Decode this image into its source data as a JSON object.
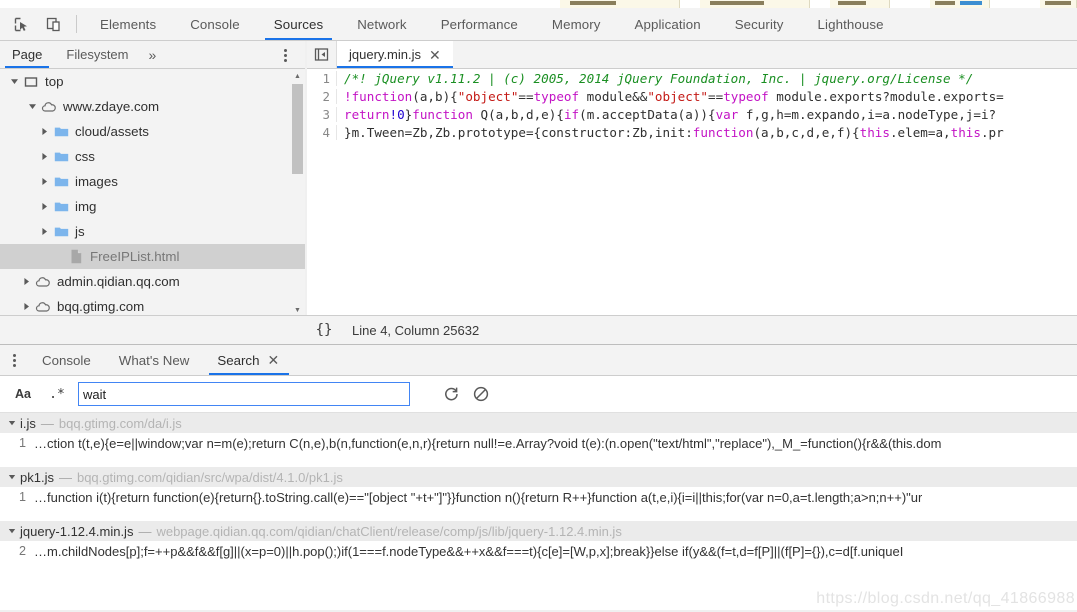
{
  "toolbar": {
    "inspect_icon": "inspect-cursor-icon",
    "device_icon": "device-toggle-icon",
    "tabs": [
      {
        "label": "Elements",
        "selected": false
      },
      {
        "label": "Console",
        "selected": false
      },
      {
        "label": "Sources",
        "selected": true
      },
      {
        "label": "Network",
        "selected": false
      },
      {
        "label": "Performance",
        "selected": false
      },
      {
        "label": "Memory",
        "selected": false
      },
      {
        "label": "Application",
        "selected": false
      },
      {
        "label": "Security",
        "selected": false
      },
      {
        "label": "Lighthouse",
        "selected": false
      }
    ]
  },
  "navigator": {
    "tabs": [
      {
        "label": "Page",
        "selected": true
      },
      {
        "label": "Filesystem",
        "selected": false
      }
    ],
    "more_label": "»",
    "kebab_icon": "more-options-icon",
    "tree": [
      {
        "label": "top",
        "icon": "frame-icon",
        "twisty": "expanded",
        "indent": 0,
        "selected": false
      },
      {
        "label": "www.zdaye.com",
        "icon": "cloud-icon",
        "twisty": "expanded",
        "indent": 1,
        "selected": false
      },
      {
        "label": "cloud/assets",
        "icon": "folder-icon",
        "twisty": "collapsed",
        "indent": 2,
        "selected": false
      },
      {
        "label": "css",
        "icon": "folder-icon",
        "twisty": "collapsed",
        "indent": 2,
        "selected": false
      },
      {
        "label": "images",
        "icon": "folder-icon",
        "twisty": "collapsed",
        "indent": 2,
        "selected": false
      },
      {
        "label": "img",
        "icon": "folder-icon",
        "twisty": "collapsed",
        "indent": 2,
        "selected": false
      },
      {
        "label": "js",
        "icon": "folder-icon",
        "twisty": "collapsed",
        "indent": 2,
        "selected": false
      },
      {
        "label": "FreeIPList.html",
        "icon": "document-icon",
        "twisty": "none",
        "indent": 3,
        "selected": true
      },
      {
        "label": "admin.qidian.qq.com",
        "icon": "cloud-icon",
        "twisty": "collapsed",
        "indent": 1,
        "selected": false
      },
      {
        "label": "bqq.gtimg.com",
        "icon": "cloud-icon",
        "twisty": "collapsed",
        "indent": 1,
        "selected": false
      }
    ]
  },
  "editor": {
    "back_icon": "show-navigator-icon",
    "tab_label": "jquery.min.js",
    "close_icon": "close-icon",
    "lines": [
      {
        "n": "1"
      },
      {
        "n": "2"
      },
      {
        "n": "3"
      },
      {
        "n": "4"
      }
    ],
    "code": {
      "line1_comment": "/*! jQuery v1.11.2 | (c) 2005, 2014 jQuery Foundation, Inc. | jquery.org/License */",
      "line2_a": "!function",
      "line2_b": "(a,b){",
      "line2_c": "\"object\"",
      "line2_d": "==",
      "line2_e": "typeof",
      "line2_f": " module&&",
      "line2_g": "\"object\"",
      "line2_h": "==",
      "line2_i": "typeof",
      "line2_j": " module.exports?module.exports=",
      "line3_a": "return",
      "line3_b": "!0",
      "line3_c": "}",
      "line3_d": "function",
      "line3_e": " Q(a,b,d,e){",
      "line3_f": "if",
      "line3_g": "(m.acceptData(a)){",
      "line3_h": "var",
      "line3_i": " f,g,h=m.expando,i=a.nodeType,j=i?",
      "line4_a": "}m.Tween=Zb,Zb.prototype={constructor:Zb,init:",
      "line4_b": "function",
      "line4_c": "(a,b,c,d,e,f){",
      "line4_d": "this",
      "line4_e": ".elem=a,",
      "line4_f": "this",
      "line4_g": ".pr"
    },
    "status": {
      "pretty_print_label": "{}",
      "cursor_position": "Line 4, Column 25632"
    }
  },
  "drawer": {
    "kebab_icon": "more-tools-icon",
    "tabs": [
      {
        "label": "Console",
        "selected": false,
        "closable": false
      },
      {
        "label": "What's New",
        "selected": false,
        "closable": false
      },
      {
        "label": "Search",
        "selected": true,
        "closable": true
      }
    ],
    "close_icon": "close-icon",
    "search": {
      "match_case_label": "Aa",
      "match_case_icon": "match-case-icon",
      "regex_label": ".*",
      "regex_icon": "regex-icon",
      "query": "wait",
      "placeholder": "",
      "refresh_icon": "refresh-icon",
      "clear_icon": "clear-icon"
    },
    "results": [
      {
        "file": "i.js",
        "dash": "—",
        "url": "bqq.gtimg.com/da/i.js",
        "twisty": "expanded",
        "matches": [
          {
            "line": "1",
            "snippet": "…ction t(t,e){e=e||window;var n=m(e);return C(n,e),b(n,function(e,n,r){return null!=e.Array?void t(e):(n.open(\"text/html\",\"replace\"),_M_=function(){r&&(this.dom"
          }
        ]
      },
      {
        "file": "pk1.js",
        "dash": "—",
        "url": "bqq.gtimg.com/qidian/src/wpa/dist/4.1.0/pk1.js",
        "twisty": "expanded",
        "matches": [
          {
            "line": "1",
            "snippet": "…function i(t){return function(e){return{}.toString.call(e)==\"[object \"+t+\"]\"}}function n(){return R++}function a(t,e,i){i=i||this;for(var n=0,a=t.length;a>n;n++)\"ur"
          }
        ]
      },
      {
        "file": "jquery-1.12.4.min.js",
        "dash": "—",
        "url": "webpage.qidian.qq.com/qidian/chatClient/release/comp/js/lib/jquery-1.12.4.min.js",
        "twisty": "expanded",
        "matches": [
          {
            "line": "2",
            "snippet": "…m.childNodes[p];f=++p&&f&&f[g]||(x=p=0)||h.pop();)if(1===f.nodeType&&++x&&f===t){c[e]=[W,p,x];break}}else if(y&&(f=t,d=f[P]||(f[P]={}),c=d[f.uniqueI"
          }
        ]
      }
    ]
  },
  "watermark": "https://blog.csdn.net/qq_41866988",
  "colors": {
    "accent": "#1a73e8",
    "toolbar_bg": "#f3f3f3",
    "selection_bg": "#d0d0d0",
    "folder_blue": "#7cb5ec",
    "comment_green": "#1a8f22",
    "keyword_magenta": "#c313c5",
    "string_red": "#c41a16",
    "number_blue": "#1c00cf"
  }
}
